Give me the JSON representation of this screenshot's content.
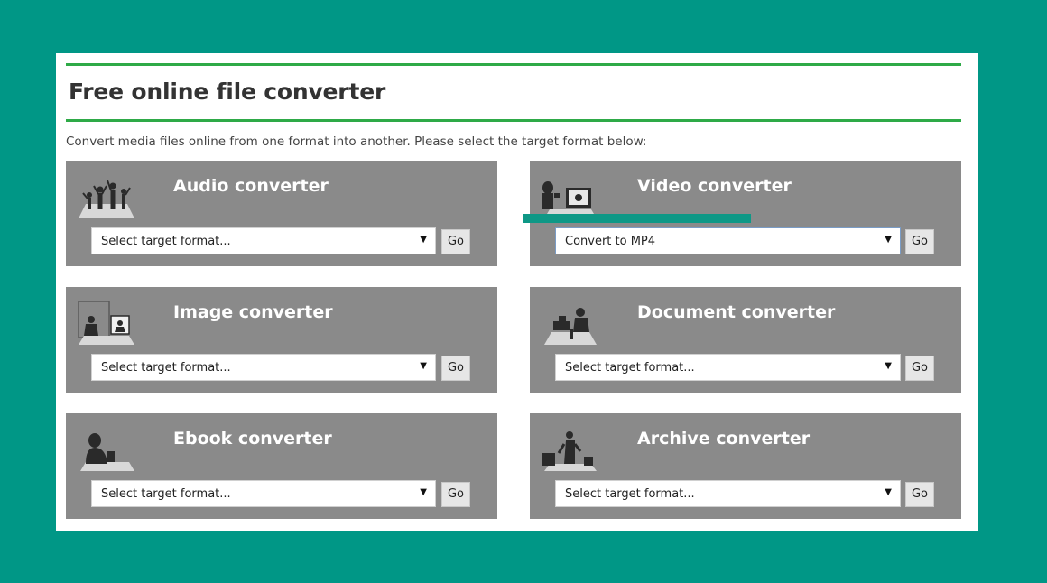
{
  "page": {
    "title": "Free online file converter",
    "intro": "Convert media files online from one format into another. Please select the target format below:"
  },
  "colors": {
    "background": "#009786",
    "accent_rule": "#2eaa47",
    "card": "#8a8a8a",
    "highlight_bar": "#0e9886"
  },
  "converters": [
    {
      "title": "Audio converter",
      "icon": "audio-people-icon",
      "select_value": "Select target format...",
      "go_label": "Go"
    },
    {
      "title": "Video converter",
      "icon": "video-camera-icon",
      "select_value": "Convert to MP4",
      "go_label": "Go"
    },
    {
      "title": "Image converter",
      "icon": "image-frame-icon",
      "select_value": "Select target format...",
      "go_label": "Go"
    },
    {
      "title": "Document converter",
      "icon": "document-desk-icon",
      "select_value": "Select target format...",
      "go_label": "Go"
    },
    {
      "title": "Ebook converter",
      "icon": "ebook-reader-icon",
      "select_value": "Select target format...",
      "go_label": "Go"
    },
    {
      "title": "Archive converter",
      "icon": "archive-boxes-icon",
      "select_value": "Select target format...",
      "go_label": "Go"
    }
  ]
}
